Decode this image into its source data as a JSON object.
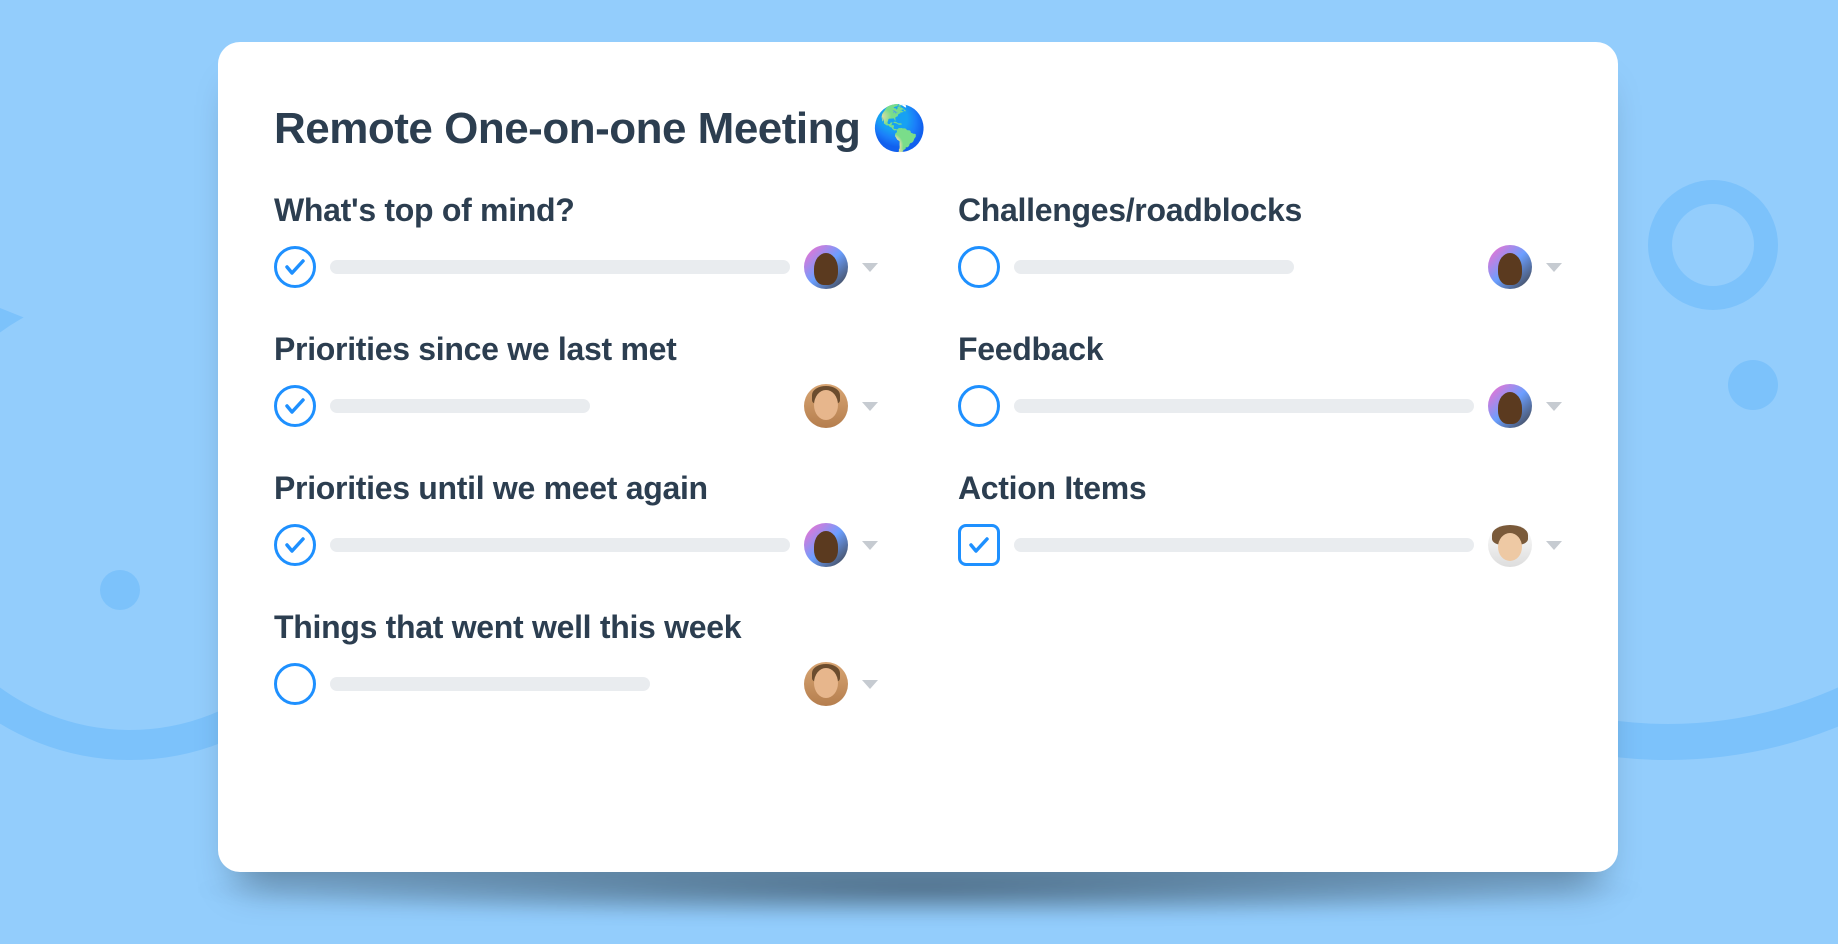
{
  "title": "Remote One-on-one Meeting 🌎",
  "sections": {
    "left": [
      {
        "title": "What's top of mind?",
        "shape": "circle",
        "checked": true,
        "bar": "full",
        "avatar": "a1"
      },
      {
        "title": "Priorities since we last met",
        "shape": "circle",
        "checked": true,
        "bar": "narrow",
        "avatar": "a2"
      },
      {
        "title": "Priorities until we meet again",
        "shape": "circle",
        "checked": true,
        "bar": "full",
        "avatar": "a1"
      },
      {
        "title": "Things that went well this week",
        "shape": "circle",
        "checked": false,
        "bar": "medium",
        "avatar": "a2"
      }
    ],
    "right": [
      {
        "title": "Challenges/roadblocks",
        "shape": "circle",
        "checked": false,
        "bar": "short",
        "avatar": "a1"
      },
      {
        "title": "Feedback",
        "shape": "circle",
        "checked": false,
        "bar": "full",
        "avatar": "a1"
      },
      {
        "title": "Action Items",
        "shape": "square",
        "checked": true,
        "bar": "full",
        "avatar": "a3"
      }
    ]
  }
}
